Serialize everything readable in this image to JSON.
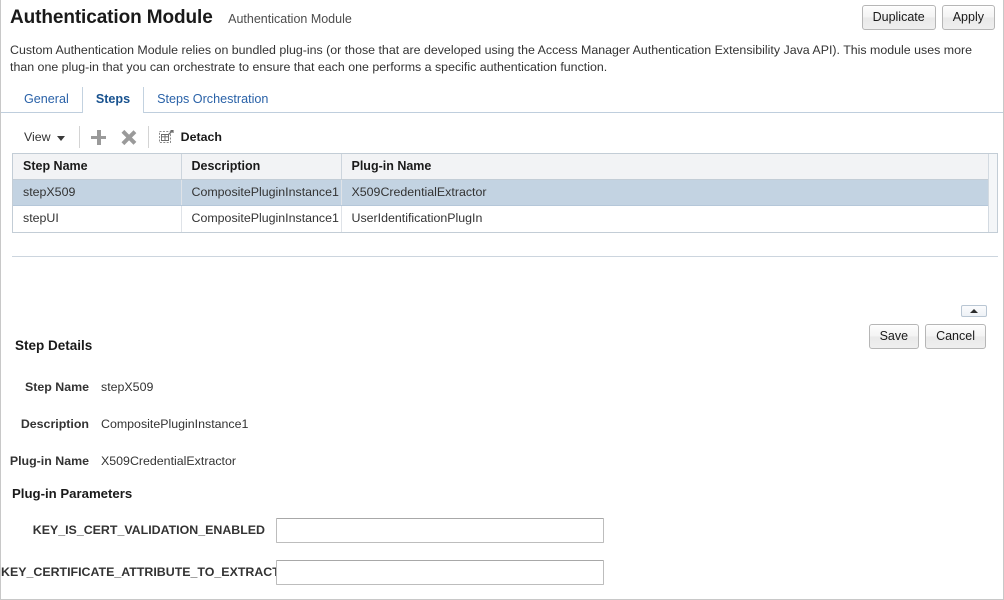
{
  "header": {
    "title": "Authentication Module",
    "subtitle": "Authentication Module",
    "duplicate_label": "Duplicate",
    "apply_label": "Apply"
  },
  "description": "Custom Authentication Module relies on bundled plug-ins (or those that are developed using the Access Manager Authentication Extensibility Java API). This module uses more than one plug-in that you can orchestrate to ensure that each one performs a specific authentication function.",
  "tabs": [
    {
      "label": "General",
      "active": false
    },
    {
      "label": "Steps",
      "active": true
    },
    {
      "label": "Steps Orchestration",
      "active": false
    }
  ],
  "toolbar": {
    "view_label": "View",
    "add_icon": "plus-icon",
    "delete_icon": "x-icon",
    "detach_label": "Detach",
    "detach_icon": "detach-icon"
  },
  "table": {
    "columns": [
      "Step Name",
      "Description",
      "Plug-in Name"
    ],
    "rows": [
      {
        "step_name": "stepX509",
        "description": "CompositePluginInstance1",
        "plugin_name": "X509CredentialExtractor",
        "selected": true
      },
      {
        "step_name": "stepUI",
        "description": "CompositePluginInstance1",
        "plugin_name": "UserIdentificationPlugIn",
        "selected": false
      }
    ]
  },
  "collapse_button": {
    "icon": "chevron-up-icon"
  },
  "step_details": {
    "title": "Step Details",
    "save_label": "Save",
    "cancel_label": "Cancel",
    "fields": [
      {
        "label": "Step Name",
        "value": "stepX509"
      },
      {
        "label": "Description",
        "value": "CompositePluginInstance1"
      },
      {
        "label": "Plug-in Name",
        "value": "X509CredentialExtractor"
      }
    ],
    "params_title": "Plug-in Parameters",
    "params": [
      {
        "label": "KEY_IS_CERT_VALIDATION_ENABLED",
        "value": "",
        "placeholder": ""
      },
      {
        "label": "KEY_CERTIFICATE_ATTRIBUTE_TO_EXTRACT",
        "value": "",
        "placeholder": ""
      }
    ]
  },
  "colors": {
    "link": "#2a62a8",
    "selected_row": "#c3d3e2",
    "header_bg": "#f2f3f5",
    "border": "#c3cdd6"
  }
}
